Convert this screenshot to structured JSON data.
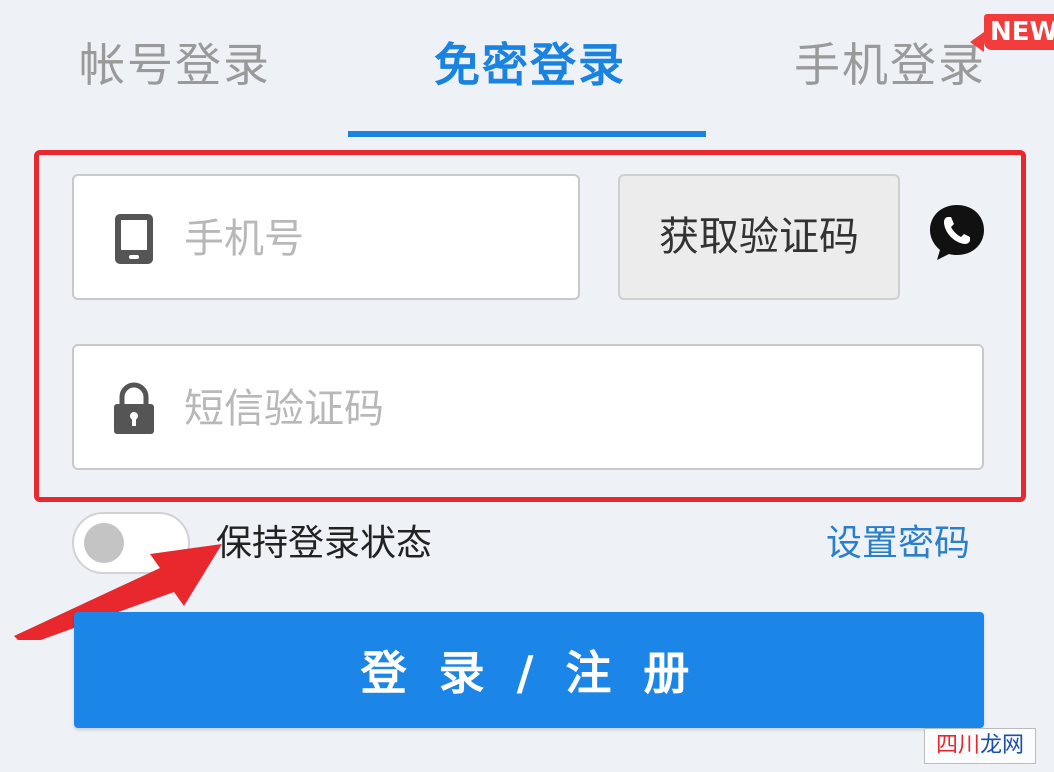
{
  "tabs": {
    "account": "帐号登录",
    "no_password": "免密登录",
    "phone": "手机登录",
    "new_badge": "NEW"
  },
  "form": {
    "phone_placeholder": "手机号",
    "code_placeholder": "短信验证码",
    "get_code_label": "获取验证码"
  },
  "options": {
    "keep_login_label": "保持登录状态",
    "set_password_link": "设置密码"
  },
  "login_button_label": "登 录 / 注 册",
  "watermark": {
    "part1": "四川",
    "part2": "龙网"
  },
  "icons": {
    "phone_field": "mobile-phone-icon",
    "code_field": "lock-icon",
    "voice": "voice-call-icon"
  },
  "colors": {
    "accent": "#1a83e0",
    "highlight": "#e8282c",
    "badge": "#f23c3c",
    "link": "#2a7fc9"
  }
}
